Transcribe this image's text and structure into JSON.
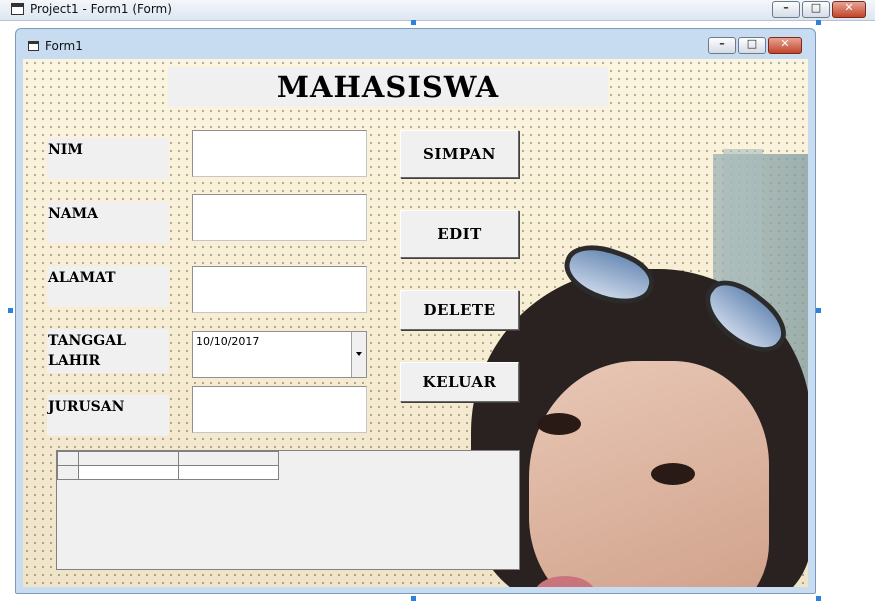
{
  "app_window": {
    "title": "Project1 - Form1 (Form)"
  },
  "form_window": {
    "title": "Form1"
  },
  "form": {
    "heading": "MAHASISWA",
    "fields": {
      "nim": {
        "label": "NIM",
        "value": ""
      },
      "nama": {
        "label": "NAMA",
        "value": ""
      },
      "alamat": {
        "label": "ALAMAT",
        "value": ""
      },
      "tanggal_lahir": {
        "label_line1": "TANGGAL",
        "label_line2": "LAHIR",
        "value": "10/10/2017"
      },
      "jurusan": {
        "label": "JURUSAN",
        "value": ""
      }
    },
    "buttons": {
      "simpan": "SIMPAN",
      "edit": "EDIT",
      "delete": "DELETE",
      "keluar": "KELUAR"
    }
  },
  "window_buttons": {
    "minimize": "–",
    "maximize": "□",
    "close": "✕"
  },
  "icons": [
    "window-icon",
    "minimize-icon",
    "maximize-icon",
    "close-icon",
    "dropdown-arrow-icon"
  ],
  "colors": {
    "form_border": "#7d9abd",
    "button_face": "#f0f0f0",
    "close_button": "#c2452b"
  }
}
